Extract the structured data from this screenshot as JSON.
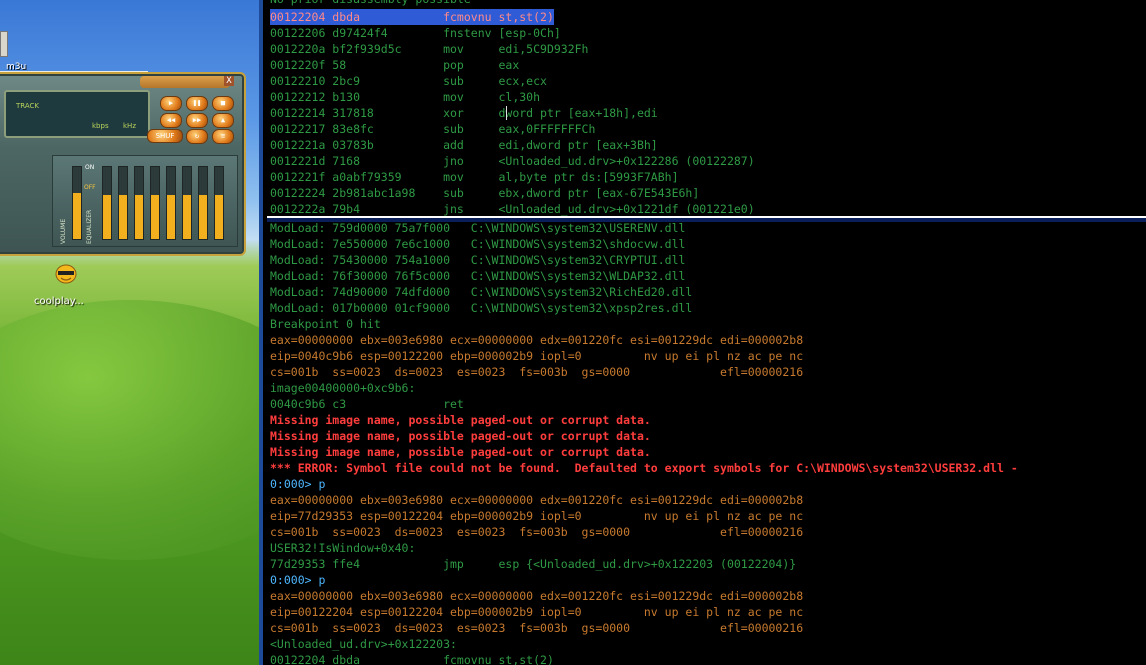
{
  "desktop": {
    "playlist_label": "m3u",
    "player": {
      "track_label": "TRACK",
      "kbps_label": "kbps",
      "khz_label": "kHz",
      "shuffle_label": "SHUF",
      "volume_label": "VOLUME",
      "equalizer_label": "EQUALIZER",
      "on_label": "ON",
      "off_label": "OFF",
      "close_label": "X"
    },
    "icon_label": "coolplay..."
  },
  "disasm": {
    "top_line": "No prior disassembly possible",
    "lines": [
      {
        "addr": "00122204",
        "bytes": "dbda",
        "mnemonic": "fcmovnu",
        "operands": "st,st(2)",
        "highlight": true
      },
      {
        "addr": "00122206",
        "bytes": "d97424f4",
        "mnemonic": "fnstenv",
        "operands": "[esp-0Ch]"
      },
      {
        "addr": "0012220a",
        "bytes": "bf2f939d5c",
        "mnemonic": "mov",
        "operands": "edi,5C9D932Fh"
      },
      {
        "addr": "0012220f",
        "bytes": "58",
        "mnemonic": "pop",
        "operands": "eax"
      },
      {
        "addr": "00122210",
        "bytes": "2bc9",
        "mnemonic": "sub",
        "operands": "ecx,ecx"
      },
      {
        "addr": "00122212",
        "bytes": "b130",
        "mnemonic": "mov",
        "operands": "cl,30h"
      },
      {
        "addr": "00122214",
        "bytes": "317818",
        "mnemonic": "xor",
        "operands": "dword ptr [eax+18h],edi"
      },
      {
        "addr": "00122217",
        "bytes": "83e8fc",
        "mnemonic": "sub",
        "operands": "eax,0FFFFFFFCh"
      },
      {
        "addr": "0012221a",
        "bytes": "03783b",
        "mnemonic": "add",
        "operands": "edi,dword ptr [eax+3Bh]"
      },
      {
        "addr": "0012221d",
        "bytes": "7168",
        "mnemonic": "jno",
        "operands": "<Unloaded_ud.drv>+0x122286 (00122287)"
      },
      {
        "addr": "0012221f",
        "bytes": "a0abf79359",
        "mnemonic": "mov",
        "operands": "al,byte ptr ds:[5993F7ABh]"
      },
      {
        "addr": "00122224",
        "bytes": "2b981abc1a98",
        "mnemonic": "sub",
        "operands": "ebx,dword ptr [eax-67E543E6h]"
      },
      {
        "addr": "0012222a",
        "bytes": "79b4",
        "mnemonic": "jns",
        "operands": "<Unloaded_ud.drv>+0x1221df (001221e0)"
      }
    ]
  },
  "command": {
    "lines": [
      {
        "text": "ModLoad: 759d0000 75a7f000   C:\\WINDOWS\\system32\\USERENV.dll",
        "style": "green"
      },
      {
        "text": "ModLoad: 7e550000 7e6c1000   C:\\WINDOWS\\system32\\shdocvw.dll",
        "style": "green"
      },
      {
        "text": "ModLoad: 75430000 754a1000   C:\\WINDOWS\\system32\\CRYPTUI.dll",
        "style": "green"
      },
      {
        "text": "ModLoad: 76f30000 76f5c000   C:\\WINDOWS\\system32\\WLDAP32.dll",
        "style": "green"
      },
      {
        "text": "ModLoad: 74d90000 74dfd000   C:\\WINDOWS\\system32\\RichEd20.dll",
        "style": "green"
      },
      {
        "text": "ModLoad: 017b0000 01cf9000   C:\\WINDOWS\\system32\\xpsp2res.dll",
        "style": "green"
      },
      {
        "text": "Breakpoint 0 hit",
        "style": "green"
      },
      {
        "text": "eax=00000000 ebx=003e6980 ecx=00000000 edx=001220fc esi=001229dc edi=000002b8",
        "style": "amber"
      },
      {
        "text": "eip=0040c9b6 esp=00122200 ebp=000002b9 iopl=0         nv up ei pl nz ac pe nc",
        "style": "amber"
      },
      {
        "text": "cs=001b  ss=0023  ds=0023  es=0023  fs=003b  gs=0000             efl=00000216",
        "style": "amber"
      },
      {
        "text": "image00400000+0xc9b6:",
        "style": "green"
      },
      {
        "text": "0040c9b6 c3              ret",
        "style": "green"
      },
      {
        "text": "Missing image name, possible paged-out or corrupt data.",
        "style": "red"
      },
      {
        "text": "Missing image name, possible paged-out or corrupt data.",
        "style": "red"
      },
      {
        "text": "Missing image name, possible paged-out or corrupt data.",
        "style": "red"
      },
      {
        "text": "*** ERROR: Symbol file could not be found.  Defaulted to export symbols for C:\\WINDOWS\\system32\\USER32.dll -",
        "style": "red"
      },
      {
        "text": "0:000> p",
        "style": "prompt"
      },
      {
        "text": "eax=00000000 ebx=003e6980 ecx=00000000 edx=001220fc esi=001229dc edi=000002b8",
        "style": "amber"
      },
      {
        "text": "eip=77d29353 esp=00122204 ebp=000002b9 iopl=0         nv up ei pl nz ac pe nc",
        "style": "amber"
      },
      {
        "text": "cs=001b  ss=0023  ds=0023  es=0023  fs=003b  gs=0000             efl=00000216",
        "style": "amber"
      },
      {
        "text": "USER32!IsWindow+0x40:",
        "style": "green"
      },
      {
        "text": "77d29353 ffe4            jmp     esp {<Unloaded_ud.drv>+0x122203 (00122204)}",
        "style": "green"
      },
      {
        "text": "0:000> p",
        "style": "prompt"
      },
      {
        "text": "eax=00000000 ebx=003e6980 ecx=00000000 edx=001220fc esi=001229dc edi=000002b8",
        "style": "amber"
      },
      {
        "text": "eip=00122204 esp=00122204 ebp=000002b9 iopl=0         nv up ei pl nz ac pe nc",
        "style": "amber"
      },
      {
        "text": "cs=001b  ss=0023  ds=0023  es=0023  fs=003b  gs=0000             efl=00000216",
        "style": "amber"
      },
      {
        "text": "<Unloaded_ud.drv>+0x122203:",
        "style": "green"
      },
      {
        "text": "00122204 dbda            fcmovnu st,st(2)",
        "style": "green"
      }
    ]
  }
}
